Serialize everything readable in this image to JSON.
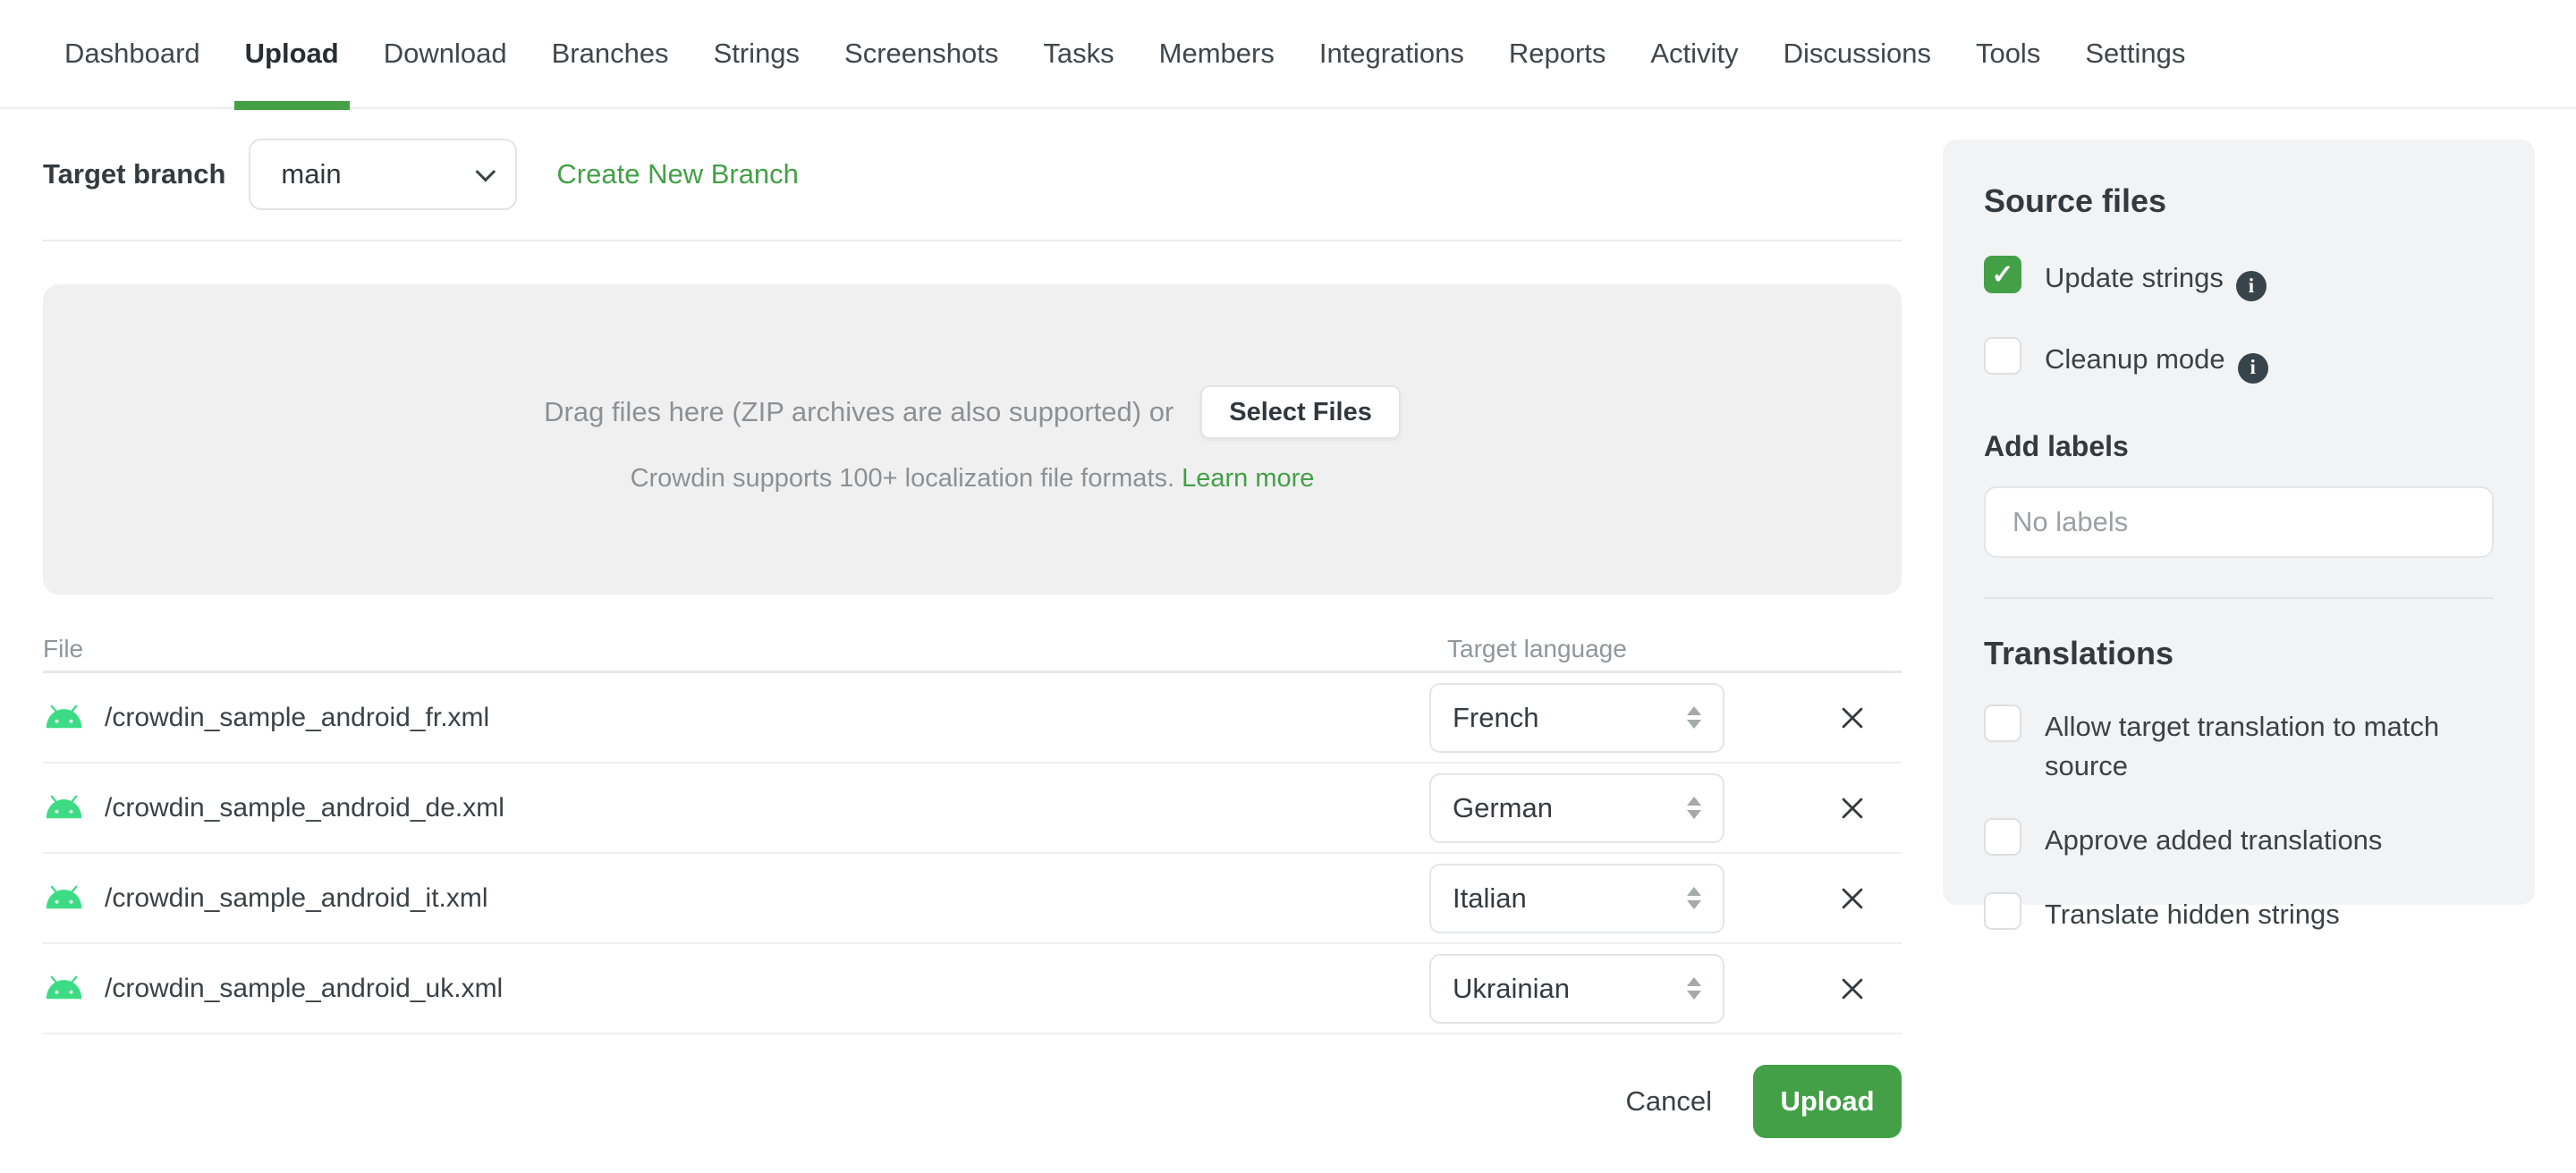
{
  "nav": {
    "items": [
      {
        "label": "Dashboard"
      },
      {
        "label": "Upload",
        "active": true
      },
      {
        "label": "Download"
      },
      {
        "label": "Branches"
      },
      {
        "label": "Strings"
      },
      {
        "label": "Screenshots"
      },
      {
        "label": "Tasks"
      },
      {
        "label": "Members"
      },
      {
        "label": "Integrations"
      },
      {
        "label": "Reports"
      },
      {
        "label": "Activity"
      },
      {
        "label": "Discussions"
      },
      {
        "label": "Tools"
      },
      {
        "label": "Settings"
      }
    ]
  },
  "branch_bar": {
    "label": "Target branch",
    "selected_branch": "main",
    "create_link": "Create New Branch"
  },
  "dropzone": {
    "drag_text": "Drag files here (ZIP archives are also supported) or",
    "select_button": "Select Files",
    "formats_text": "Crowdin supports 100+ localization file formats.",
    "learn_more": "Learn more"
  },
  "files_table": {
    "headers": {
      "file": "File",
      "target_language": "Target language"
    },
    "rows": [
      {
        "file": "/crowdin_sample_android_fr.xml",
        "language": "French"
      },
      {
        "file": "/crowdin_sample_android_de.xml",
        "language": "German"
      },
      {
        "file": "/crowdin_sample_android_it.xml",
        "language": "Italian"
      },
      {
        "file": "/crowdin_sample_android_uk.xml",
        "language": "Ukrainian"
      }
    ]
  },
  "actions": {
    "cancel": "Cancel",
    "upload": "Upload"
  },
  "sidebar": {
    "source_files": {
      "title": "Source files",
      "options": [
        {
          "label": "Update strings",
          "checked": true,
          "has_info": true
        },
        {
          "label": "Cleanup mode",
          "checked": false,
          "has_info": true
        }
      ]
    },
    "labels": {
      "title": "Add labels",
      "placeholder": "No labels"
    },
    "translations": {
      "title": "Translations",
      "options": [
        {
          "label": "Allow target translation to match source",
          "checked": false
        },
        {
          "label": "Approve added translations",
          "checked": false
        },
        {
          "label": "Translate hidden strings",
          "checked": false
        }
      ]
    }
  },
  "colors": {
    "accent_green": "#43a047",
    "android_green": "#3ddc84",
    "text_dark": "#3a4247",
    "text_gray": "#8b9195"
  }
}
